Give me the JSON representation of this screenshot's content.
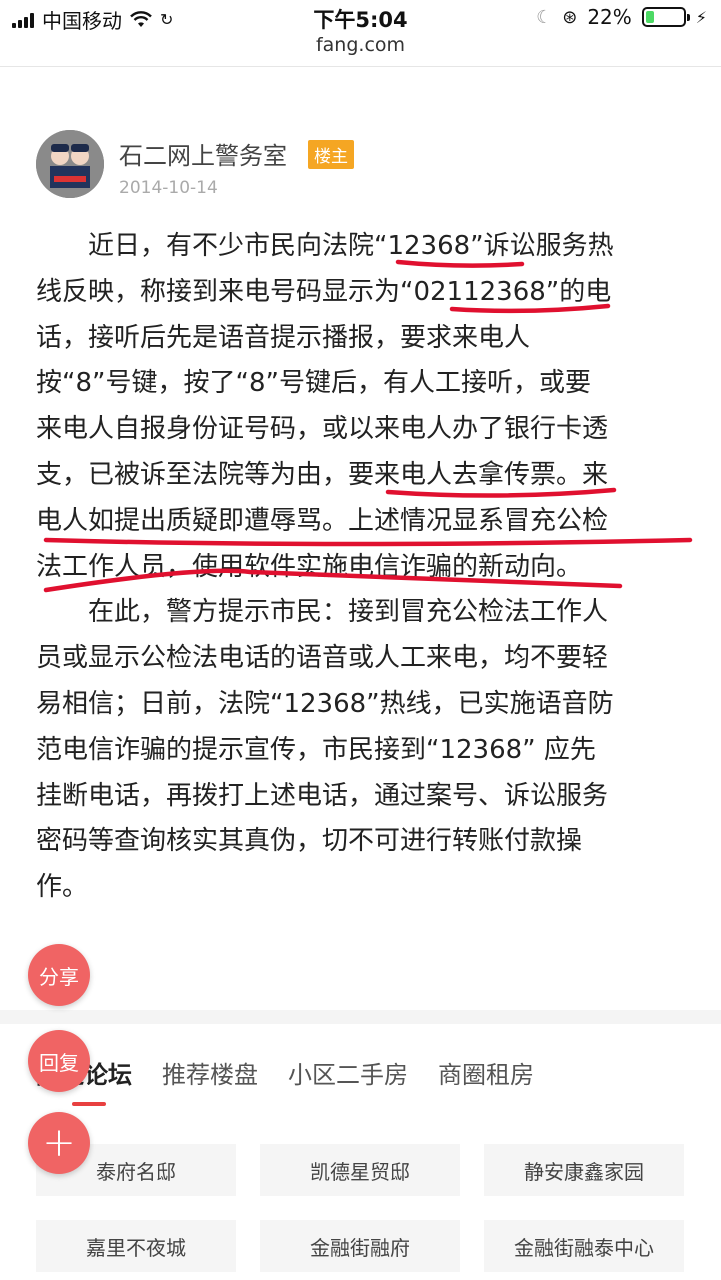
{
  "status_bar": {
    "carrier": "中国移动",
    "time": "下午5:04",
    "battery": "22%",
    "battery_level": 0.22
  },
  "url": "fang.com",
  "post": {
    "author": "石二网上警务室",
    "badge": "楼主",
    "date": "2014-10-14",
    "para1": [
      "近日，有不少市民向法院“12368”诉讼服务热",
      "线反映，称接到来电号码显示为“02112368”的电",
      "话，接听后先是语音提示播报，要求来电人",
      "按“8”号键，按了“8”号键后，有人工接听，或要",
      "来电人自报身份证号码，或以来电人办了银行卡透",
      "支，已被诉至法院等为由，要来电人去拿传票。来",
      "电人如提出质疑即遭辱骂。上述情况显系冒充公检",
      "法工作人员，使用软件实施电信诈骗的新动向。"
    ],
    "para2": [
      "在此，警方提示市民：接到冒充公检法工作人",
      "员或显示公检法电话的语音或人工来电，均不要轻",
      "易相信；日前，法院“12368”热线，已实施语音防",
      "范电信诈骗的提示宣传，市民接到“12368” 应先",
      "挂断电话，再拨打上述电话，通过案号、诉讼服务",
      "密码等查询核实其真伪，切不可进行转账付款操",
      "作。"
    ]
  },
  "actions": {
    "share": "分享",
    "reply": "回复",
    "add": "+"
  },
  "tabs": [
    {
      "label": "附近论坛",
      "active": true
    },
    {
      "label": "推荐楼盘",
      "active": false
    },
    {
      "label": "小区二手房",
      "active": false
    },
    {
      "label": "商圈租房",
      "active": false
    }
  ],
  "grid_items": [
    "泰府名邸",
    "凯德星贸邸",
    "静安康鑫家园",
    "嘉里不夜城",
    "金融街融府",
    "金融街融泰中心"
  ],
  "colors": {
    "accent": "#f06464",
    "badge": "#f5a623",
    "annotation": "#e0102f"
  }
}
